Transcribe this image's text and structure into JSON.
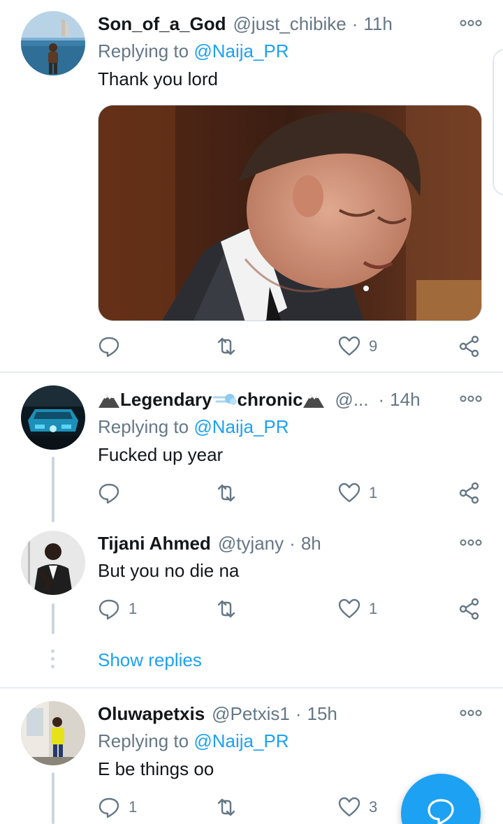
{
  "tweets": [
    {
      "name": "Son_of_a_God",
      "handle": "@just_chibike",
      "time": "11h",
      "replying_prefix": "Replying to",
      "replying_to": "@Naija_PR",
      "text": "Thank you lord",
      "has_media": true,
      "counts": {
        "reply": "",
        "retweet": "",
        "like": "9"
      }
    },
    {
      "name_part1": "Legendary",
      "name_part2": "chronic",
      "handle": "@...",
      "time": "14h",
      "replying_prefix": "Replying to",
      "replying_to": "@Naija_PR",
      "text": "Fucked up year",
      "counts": {
        "reply": "",
        "retweet": "",
        "like": "1"
      }
    },
    {
      "name": "Tijani Ahmed",
      "handle": "@tyjany",
      "time": "8h",
      "text": "But you no die na",
      "counts": {
        "reply": "1",
        "retweet": "",
        "like": "1"
      }
    },
    {
      "name": "Oluwapetxis",
      "handle": "@Petxis1",
      "time": "15h",
      "replying_prefix": "Replying to",
      "replying_to": "@Naija_PR",
      "text": "E be things oo",
      "counts": {
        "reply": "1",
        "retweet": "",
        "like": "3"
      }
    }
  ],
  "thread": {
    "show_replies": "Show replies"
  },
  "icons": {
    "reply": "reply-icon",
    "retweet": "retweet-icon",
    "like": "heart-icon",
    "share": "share-icon",
    "more": "more-options-icon",
    "compose": "compose-reply-icon"
  },
  "colors": {
    "accent": "#1da1f2",
    "secondary_text": "#657786",
    "primary_text": "#14171a",
    "divider": "#e6ecf0",
    "thread_line": "#ccd6dd"
  },
  "separator": "·"
}
